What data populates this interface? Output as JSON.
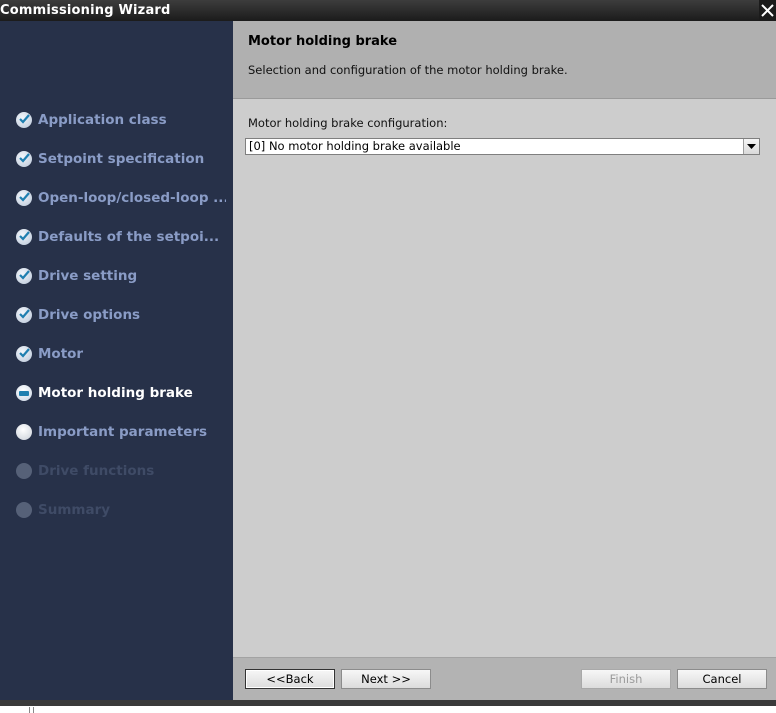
{
  "window": {
    "title": "Commissioning Wizard"
  },
  "sidebar": {
    "items": [
      {
        "label": "Application class",
        "state": "done"
      },
      {
        "label": "Setpoint specification",
        "state": "done"
      },
      {
        "label": "Open-loop/closed-loop ...",
        "state": "done"
      },
      {
        "label": "Defaults of the setpoi...",
        "state": "done"
      },
      {
        "label": "Drive setting",
        "state": "done"
      },
      {
        "label": "Drive options",
        "state": "done"
      },
      {
        "label": "Motor",
        "state": "done"
      },
      {
        "label": "Motor holding brake",
        "state": "current"
      },
      {
        "label": "Important parameters",
        "state": "pending"
      },
      {
        "label": "Drive functions",
        "state": "disabled"
      },
      {
        "label": "Summary",
        "state": "disabled"
      }
    ]
  },
  "header": {
    "title": "Motor holding brake",
    "description": "Selection and configuration of the motor holding brake."
  },
  "form": {
    "brake_config_label": "Motor holding brake configuration:",
    "brake_config_value": "[0] No motor holding brake available"
  },
  "footer": {
    "back_label": "<<Back",
    "next_label": "Next >>",
    "finish_label": "Finish",
    "cancel_label": "Cancel"
  },
  "colors": {
    "sidebar_bg": "#273149",
    "nav_text": "#8a9cc6",
    "nav_current": "#ffffff",
    "content_bg": "#cdcdcd",
    "header_bg": "#b0b0b0"
  }
}
